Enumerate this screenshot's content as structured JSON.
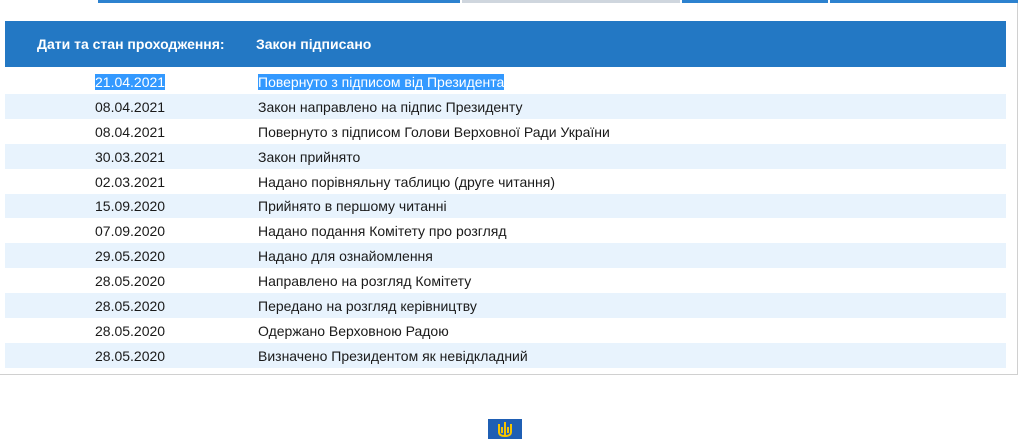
{
  "status": {
    "header_label": "Дати та стан проходження:",
    "header_value": "Закон підписано"
  },
  "history": [
    {
      "date": "21.04.2021",
      "event": "Повернуто з підписом від Президента",
      "selected": true
    },
    {
      "date": "08.04.2021",
      "event": "Закон направлено на підпис Президенту"
    },
    {
      "date": "08.04.2021",
      "event": "Повернуто з підписом Голови Верховної Ради України"
    },
    {
      "date": "30.03.2021",
      "event": "Закон прийнято"
    },
    {
      "date": "02.03.2021",
      "event": "Надано порівняльну таблицю (друге читання)"
    },
    {
      "date": "15.09.2020",
      "event": "Прийнято в першому читанні"
    },
    {
      "date": "07.09.2020",
      "event": "Надано подання Комітету про розгляд"
    },
    {
      "date": "29.05.2020",
      "event": "Надано для ознайомлення"
    },
    {
      "date": "28.05.2020",
      "event": "Направлено на розгляд Комітету"
    },
    {
      "date": "28.05.2020",
      "event": "Передано на розгляд керівництву"
    },
    {
      "date": "28.05.2020",
      "event": "Одержано Верховною Радою"
    },
    {
      "date": "28.05.2020",
      "event": "Визначено Президентом як невідкладний"
    }
  ],
  "colors": {
    "header_bg": "#2378c4",
    "row_alt_bg": "#e8f3fd",
    "selection_bg": "#3399ff",
    "emblem_blue": "#1f5fb4",
    "emblem_gold": "#f5c400"
  },
  "icons": {
    "tabs": "tab-strip",
    "emblem": "trident-emblem-icon"
  }
}
